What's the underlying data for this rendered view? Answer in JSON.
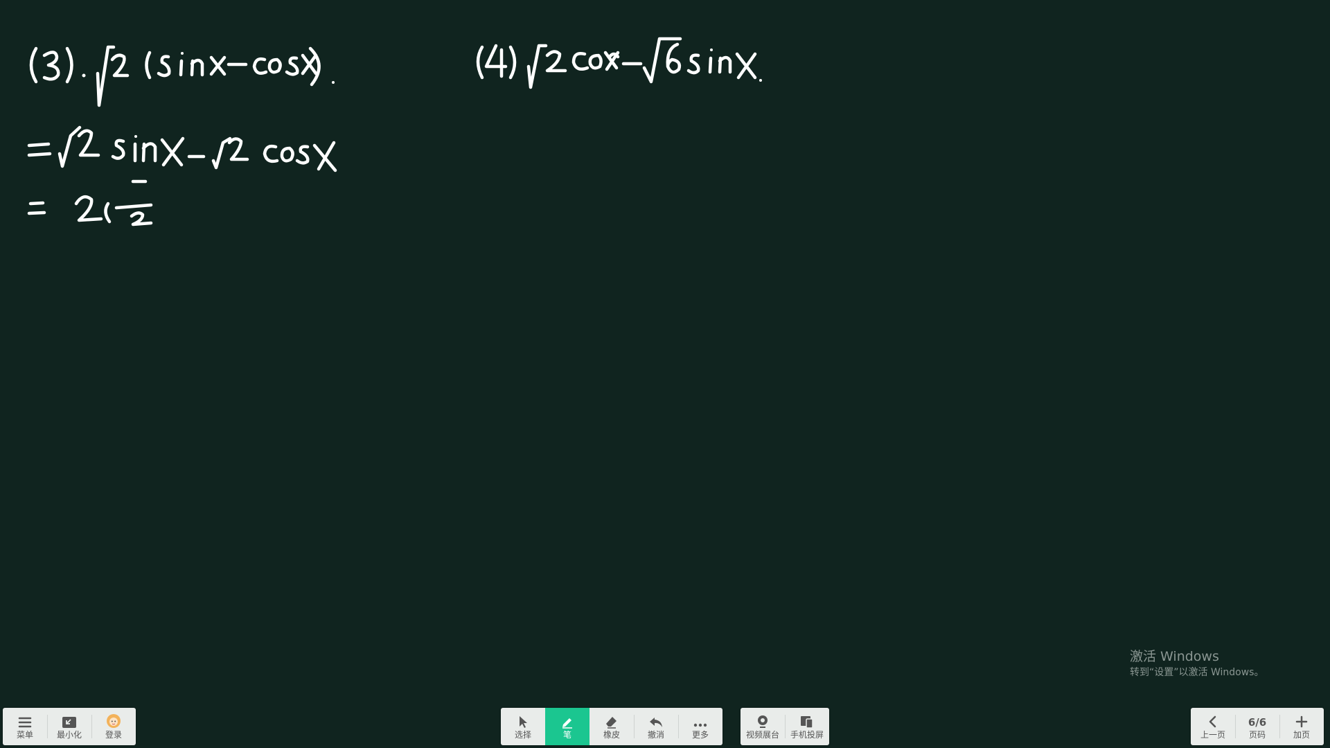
{
  "board": {
    "background": "#10241f",
    "ink_color": "#ffffff",
    "content": "Handwritten math: (3). √2(sinx−cosx). = √2 sinx − √2 cosx = 2(… ; (4) √2 cosx − √6 sinx."
  },
  "toolbar_left": {
    "menu": {
      "label": "菜单",
      "icon": "menu-icon"
    },
    "minimize": {
      "label": "最小化",
      "icon": "minimize-icon"
    },
    "login": {
      "label": "登录",
      "icon": "avatar-icon"
    }
  },
  "toolbar_center": {
    "select": {
      "label": "选择",
      "icon": "cursor-arrow-icon"
    },
    "pen": {
      "label": "笔",
      "icon": "pen-icon",
      "active": true,
      "active_color": "#1bc690"
    },
    "eraser": {
      "label": "橡皮",
      "icon": "eraser-icon"
    },
    "undo": {
      "label": "撤消",
      "icon": "undo-icon"
    },
    "more": {
      "label": "更多",
      "icon": "more-dots-icon"
    }
  },
  "toolbar_media": {
    "video_booth": {
      "label": "视频展台",
      "icon": "camera-icon"
    },
    "phone_cast": {
      "label": "手机投屏",
      "icon": "phone-cast-icon"
    }
  },
  "toolbar_right": {
    "prev": {
      "label": "上一页",
      "icon": "chevron-left-icon"
    },
    "page": {
      "value": "6/6",
      "label": "页码"
    },
    "add": {
      "label": "加页",
      "icon": "plus-icon"
    }
  },
  "watermark": {
    "line1": "激活 Windows",
    "line2": "转到“设置”以激活 Windows。"
  }
}
